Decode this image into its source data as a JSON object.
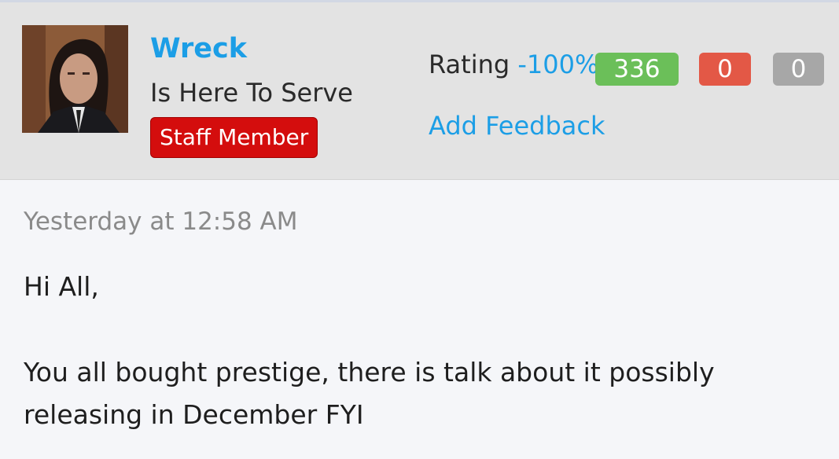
{
  "post": {
    "author": {
      "name": "Wreck",
      "title": "Is Here To Serve",
      "badge": "Staff Member"
    },
    "rating": {
      "label": "Rating",
      "percent": "-100%",
      "positive": "336",
      "negative": "0",
      "neutral": "0",
      "add_feedback": "Add Feedback",
      "colors": {
        "positive": "#6bbf59",
        "negative": "#e35846",
        "neutral": "#a7a7a7",
        "link": "#1c9ee6"
      }
    },
    "timestamp": "Yesterday at 12:58 AM",
    "body": {
      "greeting": "Hi All,",
      "text": "You all bought prestige, there is talk about it possibly releasing in December FYI"
    }
  }
}
